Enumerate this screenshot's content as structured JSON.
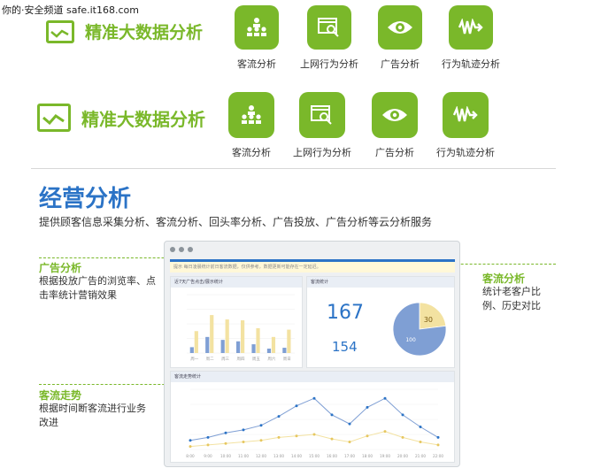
{
  "watermark": "你的·安全频道 safe.it168.com",
  "brand": {
    "title": "精准大数据分析"
  },
  "features": [
    {
      "label": "客流分析",
      "icon": "people-hierarchy-icon"
    },
    {
      "label": "上网行为分析",
      "icon": "browser-search-icon"
    },
    {
      "label": "广告分析",
      "icon": "eye-icon"
    },
    {
      "label": "行为轨迹分析",
      "icon": "wave-arrow-icon"
    }
  ],
  "section": {
    "title": "经营分析",
    "description": "提供顾客信息采集分析、客流分析、回头率分析、广告投放、广告分析等云分析服务"
  },
  "callouts": {
    "ad": {
      "title": "广告分析",
      "text": "根据投放广告的浏览率、点击率统计营销效果"
    },
    "traffic_trend": {
      "title": "客流走势",
      "text": "根据时间断客流进行业务改进"
    },
    "customer": {
      "title": "客流分析",
      "text": "统计老客户比例、历史对比"
    }
  },
  "dashboard": {
    "notice": "提示  每日凌晨统计前日客流数据，仅供参考，数据更新可能存在一定延迟。",
    "bar_panel_title": "近7天广告点击/展示统计",
    "customer_panel_title": "客流统计",
    "line_panel_title": "客流走势统计",
    "big_number_1": "167",
    "big_number_2": "154",
    "pie_label_old": "30",
    "pie_label_new": "100",
    "colors": {
      "blue": "#7f9fd4",
      "yellow": "#f3e2a1",
      "accent": "#2b73c6",
      "green": "#7ab82a"
    }
  },
  "chart_data": [
    {
      "type": "bar",
      "categories": [
        "周一",
        "周二",
        "周三",
        "周四",
        "周五",
        "周六",
        "周日"
      ],
      "series": [
        {
          "values": [
            20,
            55,
            45,
            40,
            30,
            15,
            18
          ]
        },
        {
          "values": [
            75,
            130,
            115,
            112,
            85,
            55,
            80
          ]
        }
      ],
      "ylim": [
        0,
        200
      ]
    },
    {
      "type": "pie",
      "labels": [
        "30",
        "100"
      ],
      "values": [
        30,
        100
      ]
    },
    {
      "type": "line",
      "x": [
        "8:00",
        "9:00",
        "10:00",
        "11:00",
        "12:00",
        "13:00",
        "14:00",
        "15:00",
        "16:00",
        "17:00",
        "18:00",
        "19:00",
        "20:00",
        "21:00",
        "22:00"
      ],
      "series": [
        {
          "values": [
            30,
            40,
            55,
            65,
            80,
            110,
            145,
            170,
            115,
            85,
            140,
            170,
            115,
            75,
            40
          ]
        },
        {
          "values": [
            10,
            15,
            20,
            25,
            30,
            40,
            45,
            50,
            35,
            25,
            45,
            60,
            40,
            25,
            15
          ]
        }
      ],
      "ylim": [
        0,
        200
      ]
    }
  ]
}
